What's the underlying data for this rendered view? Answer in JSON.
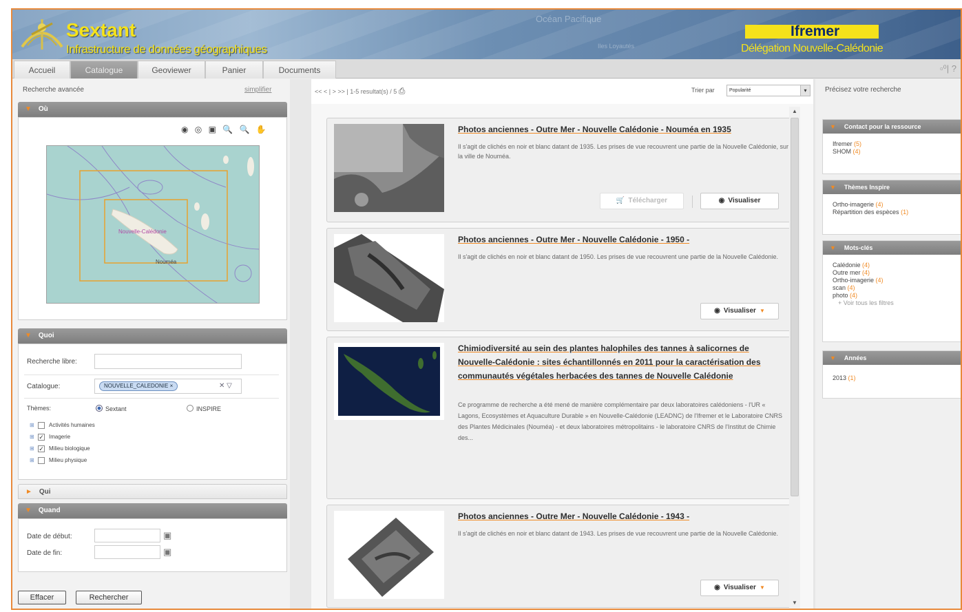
{
  "header": {
    "logo_title": "Sextant",
    "logo_subtitle": "Infrastructure de données géographiques",
    "faint_title": "Océan Pacifique",
    "faint_sub": "Iles Loyautés",
    "partner_name": "Ifremer",
    "partner_subtitle": "Délégation Nouvelle-Calédonie"
  },
  "tabs": [
    {
      "label": "Accueil",
      "active": false
    },
    {
      "label": "Catalogue",
      "active": true
    },
    {
      "label": "Geoviewer",
      "active": false
    },
    {
      "label": "Panier",
      "active": false
    },
    {
      "label": "Documents",
      "active": false
    }
  ],
  "tab_right_icons": "▫⁰| ?",
  "left": {
    "title": "Recherche avancée",
    "simplify_link": "simplifier",
    "where": {
      "title": "Où",
      "map_labels": [
        "Nouvelle-Calédonie",
        "Nouméa"
      ],
      "tools_icons": "◉ ◎ ▣ 🔍 🔍 ✋"
    },
    "what": {
      "title": "Quoi",
      "free_label": "Recherche libre:",
      "free_value": "",
      "catalog_label": "Catalogue:",
      "catalog_chip": "NOUVELLE_CALEDONIE ×",
      "catalog_clear": "✕ ▽",
      "themes_label": "Thèmes:",
      "radio_sextant": "Sextant",
      "radio_inspire": "INSPIRE",
      "themes": [
        {
          "label": "Activités humaines",
          "checked": false
        },
        {
          "label": "Imagerie",
          "checked": true
        },
        {
          "label": "Milieu biologique",
          "checked": true
        },
        {
          "label": "Milieu physique",
          "checked": false
        }
      ]
    },
    "who": {
      "title": "Qui"
    },
    "when": {
      "title": "Quand",
      "start_label": "Date de début:",
      "end_label": "Date de fin:"
    },
    "buttons": {
      "clear": "Effacer",
      "search": "Rechercher"
    }
  },
  "center": {
    "pager": "<< < | > >> | 1-5 resultat(s) / 5",
    "sort_label": "Trier par",
    "sort_value": "Popularité",
    "results": [
      {
        "title": "Photos anciennes - Outre Mer - Nouvelle Calédonie - Nouméa en 1935",
        "desc": "Il s'agit de clichés en noir et blanc datant de 1935. Les prises de vue recouvrent une partie de la Nouvelle Calédonie, sur la ville de Nouméa.",
        "download_label": "Télécharger",
        "view_label": "Visualiser"
      },
      {
        "title": "Photos anciennes - Outre Mer - Nouvelle Calédonie - 1950 -",
        "desc": "Il s'agit de clichés en noir et blanc datant de 1950. Les prises de vue recouvrent une partie de la Nouvelle Calédonie.",
        "view_label": "Visualiser"
      },
      {
        "title": "Chimiodiversité au sein des plantes halophiles des tannes à salicornes de Nouvelle-Calédonie : sites échantillonnés en 2011 pour la caractérisation des communautés végétales herbacées des tannes de Nouvelle Calédonie",
        "desc": "Ce programme de recherche a été mené de manière complémentaire par deux laboratoires calédoniens - l'UR « Lagons, Ecosystèmes et Aquaculture Durable » en Nouvelle-Calédonie (LEADNC) de l'Ifremer et le Laboratoire CNRS des Plantes Médicinales (Nouméa) - et deux laboratoires métropolitains - le laboratoire CNRS de l'Institut de Chimie des..."
      },
      {
        "title": "Photos anciennes - Outre Mer - Nouvelle Calédonie - 1943 -",
        "desc": "Il s'agit de clichés en noir et blanc datant de 1943. Les prises de vue recouvrent une partie de la Nouvelle Calédonie.",
        "view_label": "Visualiser"
      }
    ]
  },
  "right": {
    "title": "Précisez votre recherche",
    "facets": [
      {
        "title": "Contact pour la ressource",
        "items": [
          {
            "label": "Ifremer",
            "count": "(5)"
          },
          {
            "label": "SHOM",
            "count": "(4)"
          }
        ]
      },
      {
        "title": "Thèmes Inspire",
        "items": [
          {
            "label": "Ortho-imagerie",
            "count": "(4)"
          },
          {
            "label": "Répartition des espèces",
            "count": "(1)"
          }
        ]
      },
      {
        "title": "Mots-clés",
        "items": [
          {
            "label": "Calédonie",
            "count": "(4)"
          },
          {
            "label": "Outre mer",
            "count": "(4)"
          },
          {
            "label": "Ortho-imagerie",
            "count": "(4)"
          },
          {
            "label": "scan",
            "count": "(4)"
          },
          {
            "label": "photo",
            "count": "(4)"
          }
        ],
        "see_all": "+ Voir tous les filtres"
      },
      {
        "title": "Années",
        "items": [
          {
            "label": "2013",
            "count": "(1)"
          }
        ]
      }
    ]
  },
  "colors": {
    "accent": "#f08a24",
    "frame": "#e8893a",
    "brand_yellow": "#f5e21b",
    "brand_blue": "#0b2a6b"
  }
}
